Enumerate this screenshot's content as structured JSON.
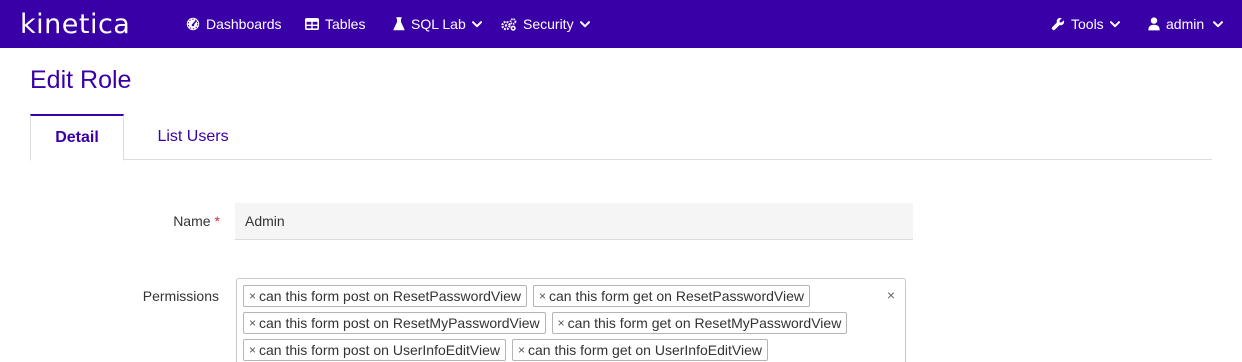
{
  "brand": {
    "name": "kinetica"
  },
  "nav": {
    "dashboards": "Dashboards",
    "tables": "Tables",
    "sql_lab": "SQL Lab",
    "security": "Security",
    "tools": "Tools",
    "user": "admin"
  },
  "page": {
    "title": "Edit Role"
  },
  "tabs": {
    "detail": "Detail",
    "list_users": "List Users"
  },
  "form": {
    "name_label": "Name",
    "name_required_mark": "*",
    "name_value": "Admin",
    "permissions_label": "Permissions",
    "clear_all_symbol": "×",
    "chip_remove_symbol": "×",
    "permissions": [
      "can this form post on ResetPasswordView",
      "can this form get on ResetPasswordView",
      "can this form post on ResetMyPasswordView",
      "can this form get on ResetMyPasswordView",
      "can this form post on UserInfoEditView",
      "can this form get on UserInfoEditView"
    ]
  },
  "colors": {
    "navbar": "#3a00a8",
    "accent": "#3a00a8",
    "required": "#d9263a"
  }
}
